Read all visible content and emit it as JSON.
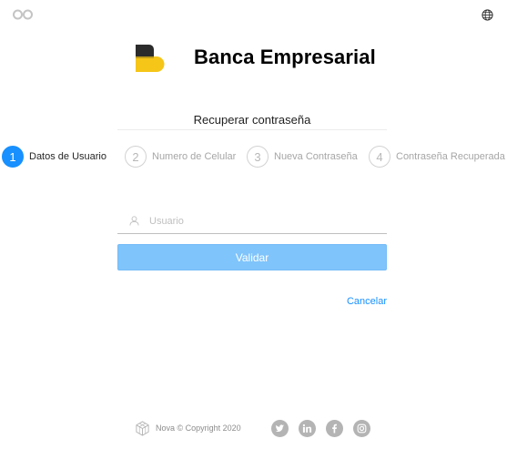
{
  "brand": {
    "name": "Banca Empresarial"
  },
  "recover": {
    "title": "Recuperar contraseña"
  },
  "steps": [
    {
      "number": "1",
      "label": "Datos de Usuario",
      "state": "active"
    },
    {
      "number": "2",
      "label": "Numero de Celular",
      "state": "pending"
    },
    {
      "number": "3",
      "label": "Nueva Contraseña",
      "state": "pending"
    },
    {
      "number": "4",
      "label": "Contraseña Recuperada",
      "state": "pending"
    }
  ],
  "form": {
    "username_placeholder": "Usuario",
    "username_value": "",
    "submit_label": "Validar",
    "cancel_label": "Cancelar"
  },
  "footer": {
    "copyright": "Nova © Copyright 2020"
  },
  "colors": {
    "accent": "#1890ff",
    "button_disabled": "#7fc4fb",
    "logo_dark": "#2b2b2b",
    "logo_yellow": "#f5c518"
  },
  "icons": {
    "top_left": "infinity-icon",
    "language": "globe-icon",
    "username": "user-icon",
    "footer_brand": "cube-icon",
    "social": [
      "twitter-icon",
      "linkedin-icon",
      "facebook-icon",
      "instagram-icon"
    ]
  }
}
